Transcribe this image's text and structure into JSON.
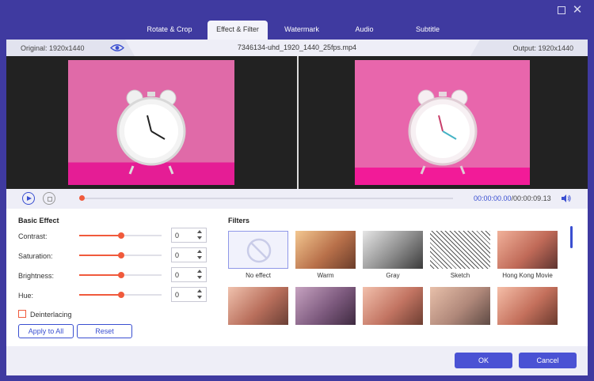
{
  "tabs": [
    {
      "label": "Rotate & Crop"
    },
    {
      "label": "Effect & Filter"
    },
    {
      "label": "Watermark"
    },
    {
      "label": "Audio"
    },
    {
      "label": "Subtitle"
    }
  ],
  "info": {
    "original": "Original: 1920x1440",
    "file_name": "7346134-uhd_1920_1440_25fps.mp4",
    "output": "Output: 1920x1440"
  },
  "playback": {
    "current_time": "00:00:00.00",
    "total_time": "/00:00:09.13",
    "progress": 0
  },
  "basic_effect": {
    "title": "Basic Effect",
    "items": [
      {
        "label": "Contrast:",
        "value": "0"
      },
      {
        "label": "Saturation:",
        "value": "0"
      },
      {
        "label": "Brightness:",
        "value": "0"
      },
      {
        "label": "Hue:",
        "value": "0"
      }
    ],
    "deinterlacing": "Deinterlacing",
    "apply_all": "Apply to All",
    "reset": "Reset"
  },
  "filters": {
    "title": "Filters",
    "items": [
      {
        "label": "No effect"
      },
      {
        "label": "Warm"
      },
      {
        "label": "Gray"
      },
      {
        "label": "Sketch"
      },
      {
        "label": "Hong Kong Movie"
      }
    ]
  },
  "footer": {
    "ok": "OK",
    "cancel": "Cancel"
  },
  "colors": {
    "accent": "#3a4fd1",
    "slider": "#f05a3c",
    "chrome": "#3f3aa0"
  }
}
